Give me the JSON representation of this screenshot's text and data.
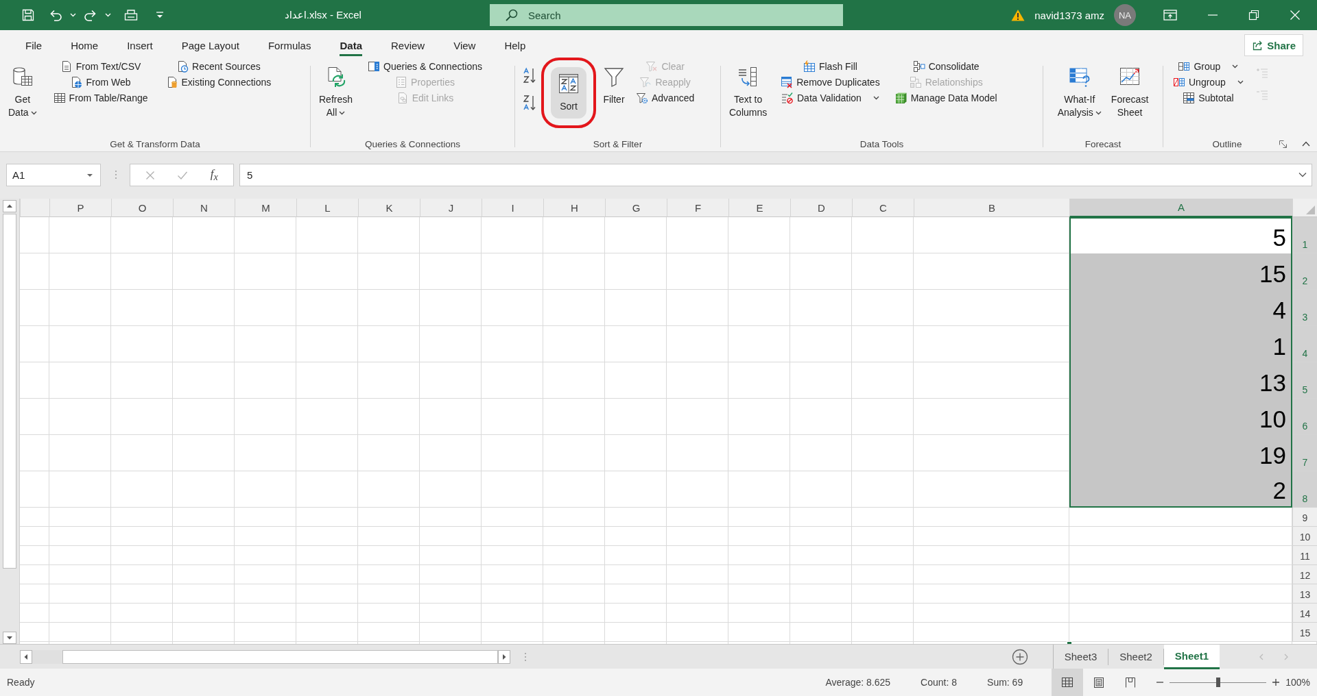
{
  "title_bar": {
    "document_title": "اعداد.xlsx - Excel",
    "search": {
      "placeholder": "Search"
    },
    "account": {
      "warning": true,
      "user_name": "navid1373 amz",
      "initials": "NA"
    }
  },
  "menu_tabs": [
    {
      "label": "File",
      "selected": false
    },
    {
      "label": "Home",
      "selected": false
    },
    {
      "label": "Insert",
      "selected": false
    },
    {
      "label": "Page Layout",
      "selected": false
    },
    {
      "label": "Formulas",
      "selected": false
    },
    {
      "label": "Data",
      "selected": true
    },
    {
      "label": "Review",
      "selected": false
    },
    {
      "label": "View",
      "selected": false
    },
    {
      "label": "Help",
      "selected": false
    }
  ],
  "share_button": {
    "label": "Share"
  },
  "ribbon_groups": [
    {
      "label": "Get & Transform Data",
      "launcher": false,
      "items": [
        {
          "kind": "large",
          "label": "Get\nData",
          "dropdown": true,
          "hovered": false,
          "circled": false
        },
        {
          "kind": "small",
          "label": "From Text/CSV",
          "disabled": false,
          "dropdown": false
        },
        {
          "kind": "small",
          "label": "From Web",
          "disabled": false,
          "dropdown": false
        },
        {
          "kind": "small",
          "label": "From Table/Range",
          "disabled": false,
          "dropdown": false
        },
        {
          "kind": "small",
          "label": "Recent Sources",
          "disabled": false,
          "dropdown": false
        },
        {
          "kind": "small",
          "label": "Existing Connections",
          "disabled": false,
          "dropdown": false
        }
      ]
    },
    {
      "label": "Queries & Connections",
      "launcher": false,
      "items": [
        {
          "kind": "large",
          "label": "Refresh\nAll",
          "dropdown": true,
          "hovered": false,
          "circled": false
        },
        {
          "kind": "small",
          "label": "Queries & Connections",
          "disabled": false,
          "dropdown": false
        },
        {
          "kind": "small",
          "label": "Properties",
          "disabled": true,
          "dropdown": false
        },
        {
          "kind": "small",
          "label": "Edit Links",
          "disabled": true,
          "dropdown": false
        }
      ]
    },
    {
      "label": "Sort & Filter",
      "launcher": false,
      "items": [
        {
          "kind": "icon",
          "disabled": false
        },
        {
          "kind": "icon",
          "disabled": false
        },
        {
          "kind": "large",
          "label": "Sort",
          "dropdown": false,
          "hovered": true,
          "circled": true
        },
        {
          "kind": "large",
          "label": "Filter",
          "dropdown": false,
          "hovered": false,
          "circled": false
        },
        {
          "kind": "small",
          "label": "Clear",
          "disabled": true,
          "dropdown": false
        },
        {
          "kind": "small",
          "label": "Reapply",
          "disabled": true,
          "dropdown": false
        },
        {
          "kind": "small",
          "label": "Advanced",
          "disabled": false,
          "dropdown": false
        }
      ]
    },
    {
      "label": "Data Tools",
      "launcher": false,
      "items": [
        {
          "kind": "large",
          "label": "Text to\nColumns",
          "dropdown": false,
          "hovered": false,
          "circled": false
        },
        {
          "kind": "small",
          "label": "Flash Fill",
          "disabled": false,
          "dropdown": false
        },
        {
          "kind": "small",
          "label": "Remove Duplicates",
          "disabled": false,
          "dropdown": false
        },
        {
          "kind": "small",
          "label": "Data Validation",
          "disabled": false,
          "dropdown": true
        },
        {
          "kind": "small",
          "label": "Consolidate",
          "disabled": false,
          "dropdown": false
        },
        {
          "kind": "small",
          "label": "Relationships",
          "disabled": true,
          "dropdown": false
        },
        {
          "kind": "small",
          "label": "Manage Data Model",
          "disabled": false,
          "dropdown": false
        }
      ]
    },
    {
      "label": "Forecast",
      "launcher": false,
      "items": [
        {
          "kind": "large",
          "label": "What-If\nAnalysis",
          "dropdown": true,
          "hovered": false,
          "circled": false
        },
        {
          "kind": "large",
          "label": "Forecast\nSheet",
          "dropdown": false,
          "hovered": false,
          "circled": false
        }
      ]
    },
    {
      "label": "Outline",
      "launcher": true,
      "items": [
        {
          "kind": "small",
          "label": "Group",
          "disabled": false,
          "dropdown": true
        },
        {
          "kind": "small",
          "label": "Ungroup",
          "disabled": false,
          "dropdown": true
        },
        {
          "kind": "small",
          "label": "Subtotal",
          "disabled": false,
          "dropdown": false
        },
        {
          "kind": "icon",
          "disabled": true
        },
        {
          "kind": "icon",
          "disabled": true
        }
      ]
    }
  ],
  "formula_bar": {
    "name_box": "A1",
    "editing": false,
    "insert_function": "f$_{x}$",
    "value": "5"
  },
  "sheet": {
    "columns": [
      {
        "label": "P",
        "selected": false
      },
      {
        "label": "O",
        "selected": false
      },
      {
        "label": "N",
        "selected": false
      },
      {
        "label": "M",
        "selected": false
      },
      {
        "label": "L",
        "selected": false
      },
      {
        "label": "K",
        "selected": false
      },
      {
        "label": "J",
        "selected": false
      },
      {
        "label": "I",
        "selected": false
      },
      {
        "label": "H",
        "selected": false
      },
      {
        "label": "G",
        "selected": false
      },
      {
        "label": "F",
        "selected": false
      },
      {
        "label": "E",
        "selected": false
      },
      {
        "label": "D",
        "selected": false
      },
      {
        "label": "C",
        "selected": false
      },
      {
        "label": "B",
        "selected": false
      },
      {
        "label": "A",
        "selected": true
      }
    ],
    "rows": [
      {
        "label": "1",
        "value": "5",
        "selected": true,
        "active": true
      },
      {
        "label": "2",
        "value": "15",
        "selected": true,
        "active": false
      },
      {
        "label": "3",
        "value": "4",
        "selected": true,
        "active": false
      },
      {
        "label": "4",
        "value": "1",
        "selected": true,
        "active": false
      },
      {
        "label": "5",
        "value": "13",
        "selected": true,
        "active": false
      },
      {
        "label": "6",
        "value": "10",
        "selected": true,
        "active": false
      },
      {
        "label": "7",
        "value": "19",
        "selected": true,
        "active": false
      },
      {
        "label": "8",
        "value": "2",
        "selected": true,
        "active": false
      },
      {
        "label": "9",
        "selected": false,
        "active": false
      },
      {
        "label": "10",
        "selected": false,
        "active": false
      },
      {
        "label": "11",
        "selected": false,
        "active": false
      },
      {
        "label": "12",
        "selected": false,
        "active": false
      },
      {
        "label": "13",
        "selected": false,
        "active": false
      },
      {
        "label": "14",
        "selected": false,
        "active": false
      },
      {
        "label": "15",
        "selected": false,
        "active": false
      }
    ]
  },
  "sheet_tabs": [
    {
      "label": "Sheet3",
      "selected": false
    },
    {
      "label": "Sheet2",
      "selected": false
    },
    {
      "label": "Sheet1",
      "selected": true
    }
  ],
  "status_bar": {
    "mode": "Ready",
    "stats": [
      "Average: 8.625",
      "Count: 8",
      "Sum: 69"
    ],
    "views": [
      {
        "selected": true
      },
      {
        "selected": false
      },
      {
        "selected": false
      }
    ],
    "zoom": {
      "level": 0.5,
      "label": "100%"
    }
  }
}
